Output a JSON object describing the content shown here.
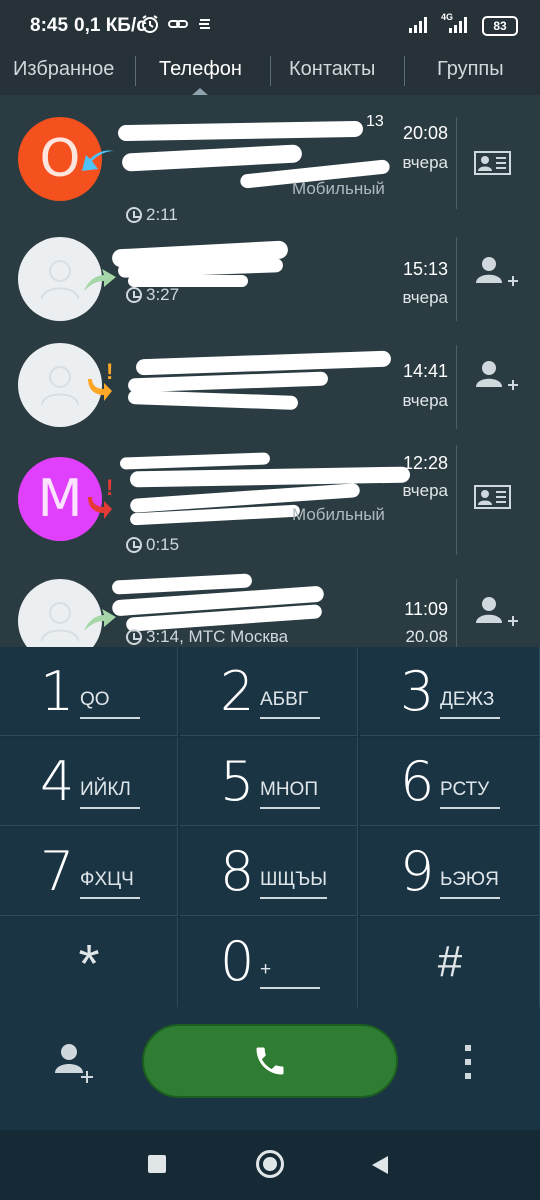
{
  "status_bar": {
    "time": "8:45",
    "speed": "0,1 КБ/с",
    "network": "4G",
    "battery": "83"
  },
  "tabs": [
    {
      "label": "Избранное"
    },
    {
      "label": "Телефон"
    },
    {
      "label": "Контакты"
    },
    {
      "label": "Группы"
    }
  ],
  "calls": [
    {
      "avatar": "О",
      "avatar_color": "#f4511e",
      "badge": "13",
      "sub_partial": "Мобильный",
      "duration": "2:11",
      "time": "20:08",
      "date": "вчера",
      "call_type": "incoming",
      "action": "contact-card-icon"
    },
    {
      "avatar": "",
      "avatar_color": "#eceff1",
      "duration": "3:27",
      "time": "15:13",
      "date": "вчера",
      "call_type": "outgoing",
      "action": "add-contact-icon"
    },
    {
      "avatar": "",
      "avatar_color": "#eceff1",
      "time": "14:41",
      "date": "вчера",
      "call_type": "missed",
      "action": "add-contact-icon"
    },
    {
      "avatar": "М",
      "avatar_color": "#e040fb",
      "sub_partial": "Мобильный",
      "duration": "0:15",
      "time": "12:28",
      "date": "вчера",
      "call_type": "missed",
      "action": "contact-card-icon"
    },
    {
      "avatar": "",
      "avatar_color": "#eceff1",
      "duration": "3:14, МТС Москва",
      "time": "11:09",
      "date": "20.08",
      "call_type": "outgoing",
      "action": "add-contact-icon"
    }
  ],
  "dialpad": {
    "keys": [
      {
        "digit": "1",
        "letters": "QO"
      },
      {
        "digit": "2",
        "letters": "АБВГ"
      },
      {
        "digit": "3",
        "letters": "ДЕЖЗ"
      },
      {
        "digit": "4",
        "letters": "ИЙКЛ"
      },
      {
        "digit": "5",
        "letters": "МНОП"
      },
      {
        "digit": "6",
        "letters": "РСТУ"
      },
      {
        "digit": "7",
        "letters": "ФХЦЧ"
      },
      {
        "digit": "8",
        "letters": "ШЩЪЫ"
      },
      {
        "digit": "9",
        "letters": "ЬЭЮЯ"
      },
      {
        "digit": "*",
        "letters": ""
      },
      {
        "digit": "0",
        "letters": "+"
      },
      {
        "digit": "#",
        "letters": ""
      }
    ]
  },
  "icons": {
    "add_contact": "add-contact-icon",
    "call": "phone-icon",
    "more": "more-vert-icon"
  },
  "colors": {
    "call_button": "#2e7d32",
    "incoming_arrow": "#4fc3f7",
    "outgoing_arrow": "#a5d6a7",
    "missed_mark": "#e53935",
    "missed_warn": "#ffa726"
  }
}
